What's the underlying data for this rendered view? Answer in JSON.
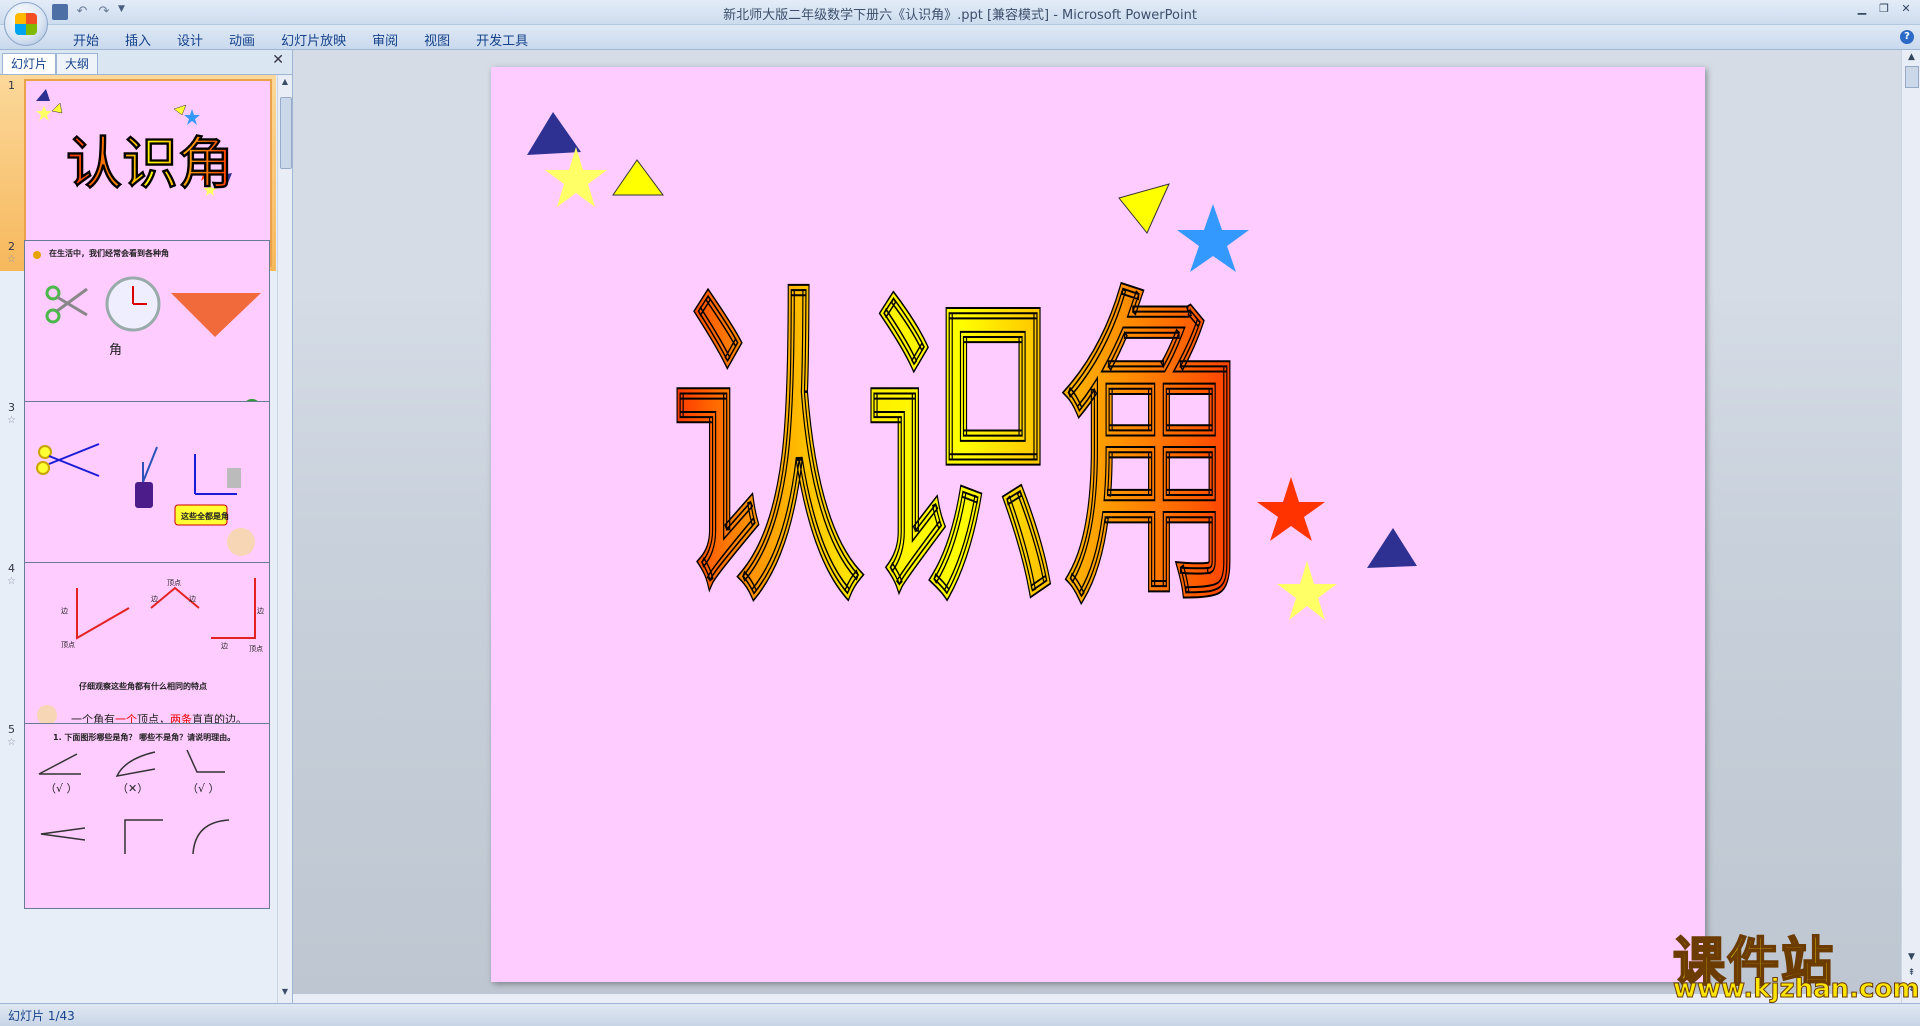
{
  "window": {
    "title": "新北师大版二年级数学下册六《认识角》.ppt [兼容模式] - Microsoft PowerPoint"
  },
  "ribbon": {
    "tabs": [
      "开始",
      "插入",
      "设计",
      "动画",
      "幻灯片放映",
      "审阅",
      "视图",
      "开发工具"
    ]
  },
  "pane": {
    "tabs": [
      "幻灯片",
      "大纲"
    ],
    "close": "✕"
  },
  "thumbnails": [
    {
      "num": "1",
      "title": "认识角"
    },
    {
      "num": "2",
      "text": "在生活中，我们经常会看到各种角",
      "label": "角"
    },
    {
      "num": "3",
      "bubble": "这些全都是角"
    },
    {
      "num": "4",
      "vertex": "顶点",
      "side": "边",
      "question": "仔细观察这些角都有什么相同的特点",
      "answer_pre": "一个角有",
      "answer_red1": "一个",
      "answer_mid": "顶点，",
      "answer_red2": "两条",
      "answer_post": "直直的边。"
    },
    {
      "num": "5",
      "question": "1. 下面图形哪些是角？ 哪些不是角？请说明理由。",
      "marks": [
        "（√ ）",
        "（✕）",
        "（√ ）"
      ]
    }
  ],
  "slide": {
    "title": "认识角"
  },
  "status": {
    "slide_indicator": "幻灯片 1/43"
  },
  "watermark": {
    "brand": "课件站",
    "url": "www.kjzhan.com"
  },
  "colors": {
    "slide_bg": "#ffccff",
    "triangle_navy": "#2e3192",
    "yellow": "#ffff33",
    "blue_star": "#3399ff",
    "red_star": "#ff3300"
  }
}
